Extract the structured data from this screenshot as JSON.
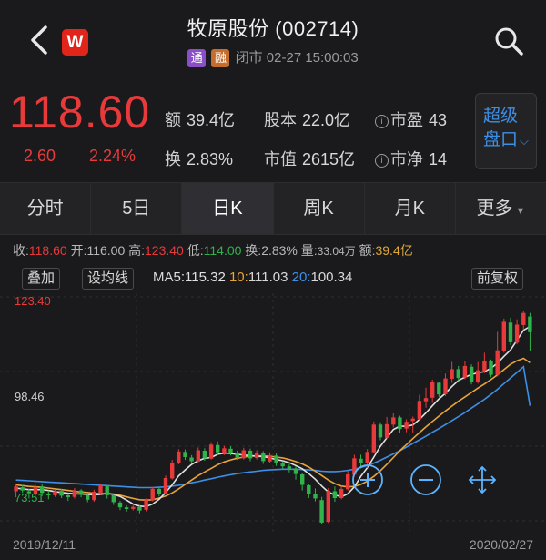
{
  "header": {
    "title": "牧原股份 (002714)",
    "badge_tong": "通",
    "badge_rong": "融",
    "status": "闭市 02-27 15:00:03",
    "logo_text": "W"
  },
  "quote": {
    "price": "118.60",
    "change": "2.60",
    "change_pct": "2.24%",
    "amount_label": "额",
    "amount": "39.4亿",
    "shares_label": "股本",
    "shares": "22.0亿",
    "pe_label": "市盈",
    "pe": "43",
    "turnover_label": "换",
    "turnover": "2.83%",
    "mcap_label": "市值",
    "mcap": "2615亿",
    "pb_label": "市净",
    "pb": "14",
    "super_line1": "超级",
    "super_line2": "盘口"
  },
  "tabs": [
    "分时",
    "5日",
    "日K",
    "周K",
    "月K",
    "更多"
  ],
  "active_tab": "日K",
  "infobar": {
    "close_label": "收:",
    "close": "118.60",
    "open_label": "开:",
    "open": "116.00",
    "high_label": "高:",
    "high": "123.40",
    "low_label": "低:",
    "low": "114.00",
    "turn_label": "换:",
    "turn": "2.83%",
    "vol_label": "量:",
    "vol": "33.04万",
    "amt_label": "额:",
    "amt": "39.4亿"
  },
  "mabar": {
    "overlay": "叠加",
    "set_ma": "设均线",
    "ma_prefix": "MA",
    "ma5_label": "5:",
    "ma5": "115.32",
    "ma10_label": "10:",
    "ma10": "111.03",
    "ma20_label": "20:",
    "ma20": "100.34",
    "adjust": "前复权"
  },
  "colors": {
    "up": "#e83a3a",
    "down": "#2fb34a",
    "ma5": "#e0e0e0",
    "ma10": "#e8a33a",
    "ma20": "#3d8fe6",
    "accent": "#3d8fe6"
  },
  "chart_data": {
    "type": "candlestick",
    "y_labels": [
      "123.40",
      "98.46",
      "73.51"
    ],
    "ylim": [
      70.5,
      126.5
    ],
    "x_start": "2019/12/11",
    "x_end": "2020/02/27",
    "candles": [
      [
        79.0,
        80.2,
        77.5,
        80.8
      ],
      [
        80.0,
        79.2,
        78.6,
        80.6
      ],
      [
        79.0,
        78.5,
        77.2,
        79.6
      ],
      [
        78.2,
        80.1,
        77.9,
        80.6
      ],
      [
        80.2,
        78.6,
        77.8,
        80.7
      ],
      [
        78.4,
        78.0,
        77.0,
        79.2
      ],
      [
        78.0,
        79.0,
        77.6,
        79.5
      ],
      [
        79.1,
        77.9,
        77.3,
        79.6
      ],
      [
        78.0,
        77.5,
        76.6,
        78.5
      ],
      [
        77.6,
        79.3,
        77.2,
        79.8
      ],
      [
        79.2,
        78.1,
        77.5,
        79.5
      ],
      [
        78.0,
        76.9,
        76.3,
        78.3
      ],
      [
        76.8,
        78.9,
        76.4,
        79.4
      ],
      [
        78.6,
        80.3,
        78.1,
        80.9
      ],
      [
        80.2,
        78.0,
        77.2,
        80.5
      ],
      [
        78.0,
        76.3,
        75.6,
        78.3
      ],
      [
        76.2,
        75.0,
        74.3,
        76.6
      ],
      [
        75.0,
        74.6,
        73.9,
        75.5
      ],
      [
        74.6,
        75.1,
        74.2,
        75.8
      ],
      [
        75.1,
        74.2,
        73.5,
        75.6
      ],
      [
        74.4,
        76.8,
        74.0,
        77.2
      ],
      [
        76.8,
        79.6,
        76.5,
        80.1
      ],
      [
        79.6,
        78.4,
        77.7,
        80.0
      ],
      [
        78.5,
        82.3,
        78.2,
        82.9
      ],
      [
        82.2,
        86.1,
        81.9,
        86.8
      ],
      [
        86.0,
        88.9,
        85.7,
        89.5
      ],
      [
        88.8,
        87.5,
        86.8,
        89.4
      ],
      [
        87.4,
        86.5,
        85.8,
        88.0
      ],
      [
        86.4,
        89.2,
        86.0,
        89.9
      ],
      [
        89.1,
        87.2,
        86.6,
        89.7
      ],
      [
        87.1,
        90.6,
        86.9,
        91.2
      ],
      [
        90.5,
        88.7,
        88.1,
        91.4
      ],
      [
        88.6,
        89.7,
        88.0,
        90.3
      ],
      [
        89.6,
        88.5,
        87.9,
        90.2
      ],
      [
        88.5,
        87.3,
        86.8,
        89.1
      ],
      [
        87.2,
        89.2,
        86.9,
        89.8
      ],
      [
        89.1,
        87.2,
        86.5,
        89.6
      ],
      [
        87.3,
        88.6,
        86.9,
        89.2
      ],
      [
        88.5,
        86.5,
        85.8,
        89.0
      ],
      [
        86.4,
        88.0,
        86.0,
        88.7
      ],
      [
        87.9,
        86.0,
        85.3,
        88.4
      ],
      [
        85.9,
        85.2,
        84.6,
        86.5
      ],
      [
        85.2,
        84.6,
        83.7,
        85.8
      ],
      [
        84.7,
        83.3,
        81.9,
        85.2
      ],
      [
        83.2,
        80.6,
        79.2,
        83.6
      ],
      [
        80.5,
        78.2,
        77.3,
        80.8
      ],
      [
        78.2,
        77.2,
        76.5,
        79.7
      ],
      [
        76.8,
        71.2,
        70.8,
        77.6
      ],
      [
        71.4,
        79.1,
        71.1,
        79.8
      ],
      [
        79.0,
        77.3,
        76.4,
        80.2
      ],
      [
        77.3,
        79.6,
        77.0,
        80.3
      ],
      [
        79.5,
        83.2,
        79.2,
        84.0
      ],
      [
        83.1,
        87.2,
        82.6,
        88.1
      ],
      [
        87.1,
        86.0,
        84.7,
        88.1
      ],
      [
        86.0,
        88.8,
        84.8,
        89.5
      ],
      [
        88.7,
        95.6,
        88.4,
        96.4
      ],
      [
        95.6,
        92.4,
        91.7,
        96.2
      ],
      [
        92.3,
        95.7,
        92.0,
        97.5
      ],
      [
        95.6,
        97.4,
        94.9,
        98.4
      ],
      [
        97.4,
        94.5,
        93.6,
        97.8
      ],
      [
        94.6,
        96.3,
        93.7,
        96.9
      ],
      [
        96.5,
        97.1,
        93.6,
        97.6
      ],
      [
        97.0,
        101.5,
        96.7,
        103.0
      ],
      [
        101.4,
        102.2,
        99.8,
        104.8
      ],
      [
        102.3,
        106.1,
        101.0,
        106.8
      ],
      [
        106.0,
        103.1,
        102.4,
        106.2
      ],
      [
        103.2,
        107.1,
        102.7,
        108.3
      ],
      [
        107.0,
        109.4,
        106.0,
        111.2
      ],
      [
        109.4,
        107.2,
        106.4,
        110.2
      ],
      [
        107.3,
        110.2,
        106.9,
        111.5
      ],
      [
        110.0,
        106.3,
        105.6,
        110.6
      ],
      [
        106.2,
        109.1,
        105.8,
        111.2
      ],
      [
        109.0,
        111.3,
        108.4,
        113.5
      ],
      [
        111.3,
        108.0,
        107.4,
        111.8
      ],
      [
        108.0,
        114.1,
        107.6,
        118.7
      ],
      [
        114.0,
        121.2,
        113.5,
        122.0
      ],
      [
        121.0,
        116.1,
        115.4,
        122.2
      ],
      [
        116.0,
        120.5,
        115.6,
        121.8
      ],
      [
        120.4,
        123.4,
        119.2,
        124.0
      ],
      [
        122.5,
        118.6,
        114.0,
        123.4
      ]
    ],
    "ma5": [
      79.8,
      79.6,
      79.4,
      79.4,
      79.4,
      79.2,
      78.9,
      78.7,
      78.5,
      78.4,
      78.3,
      78.2,
      78.1,
      78.2,
      78.5,
      78.2,
      77.7,
      76.8,
      75.8,
      75.3,
      75.2,
      75.8,
      77.0,
      78.7,
      80.6,
      82.8,
      84.3,
      85.7,
      86.6,
      87.2,
      87.4,
      88.2,
      88.5,
      88.4,
      88.2,
      88.0,
      87.9,
      87.7,
      87.6,
      87.3,
      86.9,
      86.6,
      86.1,
      85.4,
      84.6,
      83.4,
      82.0,
      80.3,
      78.8,
      78.1,
      77.6,
      78.4,
      80.1,
      82.7,
      84.9,
      87.5,
      90.2,
      92.3,
      94.4,
      95.2,
      95.2,
      95.5,
      96.9,
      98.5,
      100.3,
      102.0,
      103.4,
      105.1,
      106.6,
      107.4,
      108.1,
      108.5,
      108.8,
      109.6,
      110.9,
      112.6,
      114.2,
      116.6,
      119.1,
      120.0
    ],
    "ma10": [
      80.6,
      80.4,
      80.2,
      80.1,
      80.0,
      79.8,
      79.6,
      79.4,
      79.2,
      79.0,
      78.8,
      78.7,
      78.5,
      78.4,
      78.4,
      78.3,
      78.0,
      77.6,
      77.2,
      76.9,
      76.8,
      76.9,
      77.3,
      77.8,
      78.6,
      79.6,
      80.7,
      81.8,
      82.9,
      83.8,
      84.7,
      85.6,
      86.3,
      86.8,
      87.2,
      87.5,
      87.7,
      87.8,
      87.8,
      87.7,
      87.5,
      87.3,
      86.9,
      86.4,
      85.8,
      85.0,
      84.0,
      82.9,
      81.8,
      80.9,
      80.3,
      80.1,
      80.2,
      80.7,
      81.5,
      82.7,
      84.1,
      85.7,
      87.4,
      89.1,
      90.6,
      92.1,
      93.6,
      95.0,
      96.4,
      97.7,
      99.0,
      100.2,
      101.4,
      102.5,
      103.6,
      104.7,
      105.7,
      106.8,
      108.0,
      109.3,
      110.6,
      111.5,
      112.1,
      111.0
    ],
    "ma20": [
      81.8,
      81.7,
      81.6,
      81.5,
      81.4,
      81.3,
      81.2,
      81.1,
      81.0,
      80.9,
      80.8,
      80.7,
      80.6,
      80.5,
      80.4,
      80.3,
      80.2,
      80.1,
      80.0,
      79.9,
      79.9,
      79.9,
      80.0,
      80.1,
      80.3,
      80.5,
      80.8,
      81.1,
      81.4,
      81.8,
      82.1,
      82.5,
      82.8,
      83.1,
      83.4,
      83.6,
      83.8,
      84.0,
      84.2,
      84.3,
      84.4,
      84.5,
      84.5,
      84.5,
      84.4,
      84.3,
      84.2,
      84.0,
      83.9,
      83.9,
      84.0,
      84.2,
      84.5,
      84.9,
      85.4,
      86.0,
      86.7,
      87.5,
      88.3,
      89.1,
      90.0,
      90.9,
      91.8,
      92.7,
      93.7,
      94.6,
      95.6,
      96.6,
      97.6,
      98.6,
      99.7,
      100.8,
      101.9,
      103.1,
      104.4,
      105.8,
      107.2,
      108.6,
      110.0,
      100.3
    ]
  }
}
